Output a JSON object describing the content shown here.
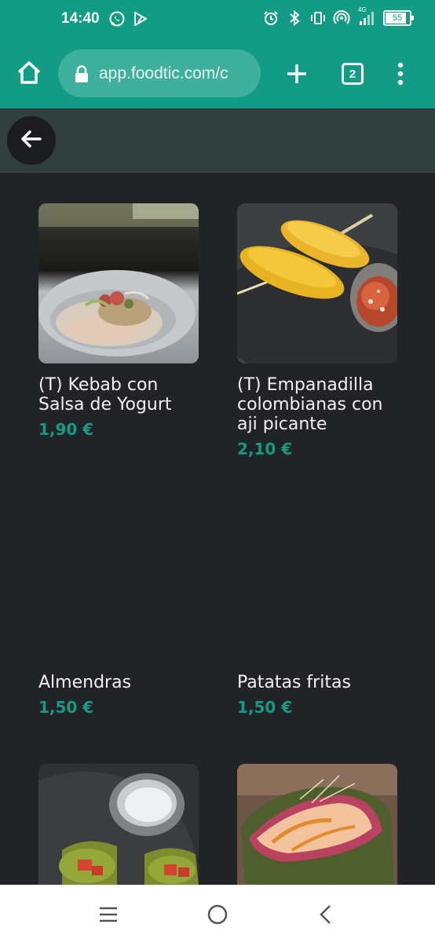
{
  "status_bar": {
    "time": "14:40",
    "battery": "55",
    "network": "4G",
    "icons": [
      "whatsapp-icon",
      "play-store-icon",
      "alarm-icon",
      "bluetooth-icon",
      "vibrate-icon",
      "hotspot-icon",
      "signal-icon",
      "battery-icon"
    ]
  },
  "browser": {
    "url": "app.foodtic.com/c",
    "tab_count": "2",
    "icons": [
      "home-icon",
      "lock-icon",
      "plus-icon",
      "tabs-icon",
      "more-vert-icon"
    ]
  },
  "header": {
    "back_icon": "arrow-left-icon"
  },
  "products": [
    {
      "name": "(T) Kebab con Salsa de Yogurt",
      "price": "1,90 €",
      "has_image": true
    },
    {
      "name": "(T) Empanadilla colombianas con aji picante",
      "price": "2,10 €",
      "has_image": true
    },
    {
      "name": "Almendras",
      "price": "1,50 €",
      "has_image": false
    },
    {
      "name": "Patatas fritas",
      "price": "1,50 €",
      "has_image": false
    },
    {
      "name": "",
      "price": "",
      "has_image": true
    },
    {
      "name": "",
      "price": "",
      "has_image": true
    }
  ],
  "nav": {
    "icons": [
      "recents-icon",
      "home-circle-icon",
      "back-chevron-icon"
    ]
  },
  "colors": {
    "accent": "#129c85",
    "price": "#139c84",
    "background": "#222327",
    "header": "#2e3f3d"
  }
}
